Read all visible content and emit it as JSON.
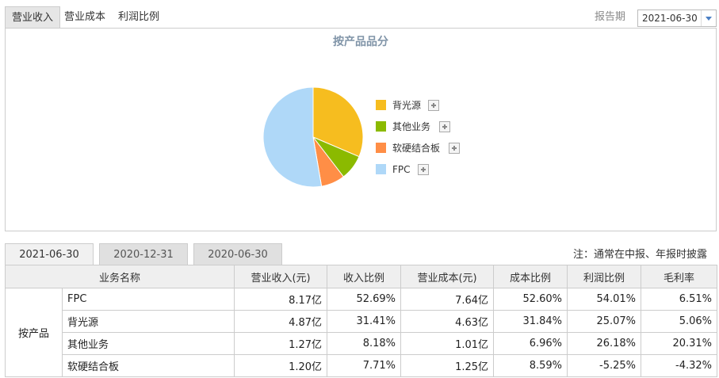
{
  "top_tabs": [
    {
      "label": "营业收入",
      "active": true
    },
    {
      "label": "营业成本",
      "active": false
    },
    {
      "label": "利润比例",
      "active": false
    }
  ],
  "report_period": {
    "label": "报告期",
    "selected": "2021-06-30"
  },
  "chart": {
    "title": "按产品品分"
  },
  "chart_data": {
    "type": "pie",
    "title": "按产品品分",
    "slices": [
      {
        "label": "背光源",
        "value": 31.41,
        "color": "#f6bd1f"
      },
      {
        "label": "其他业务",
        "value": 8.18,
        "color": "#8bba00"
      },
      {
        "label": "软硬结合板",
        "value": 7.71,
        "color": "#ff8e46"
      },
      {
        "label": "FPC",
        "value": 52.69,
        "color": "#afd8f8"
      }
    ]
  },
  "date_tabs": [
    {
      "label": "2021-06-30",
      "active": true
    },
    {
      "label": "2020-12-31",
      "active": false
    },
    {
      "label": "2020-06-30",
      "active": false
    }
  ],
  "note": "注：通常在中报、年报时披露",
  "table": {
    "headers": [
      "业务名称",
      "营业收入(元)",
      "收入比例",
      "营业成本(元)",
      "成本比例",
      "利润比例",
      "毛利率"
    ],
    "group_label": "按产品",
    "rows": [
      [
        "FPC",
        "8.17亿",
        "52.69%",
        "7.64亿",
        "52.60%",
        "54.01%",
        "6.51%"
      ],
      [
        "背光源",
        "4.87亿",
        "31.41%",
        "4.63亿",
        "31.84%",
        "25.07%",
        "5.06%"
      ],
      [
        "其他业务",
        "1.27亿",
        "8.18%",
        "1.01亿",
        "6.96%",
        "26.18%",
        "20.31%"
      ],
      [
        "软硬结合板",
        "1.20亿",
        "7.71%",
        "1.25亿",
        "8.59%",
        "-5.25%",
        "-4.32%"
      ]
    ]
  }
}
